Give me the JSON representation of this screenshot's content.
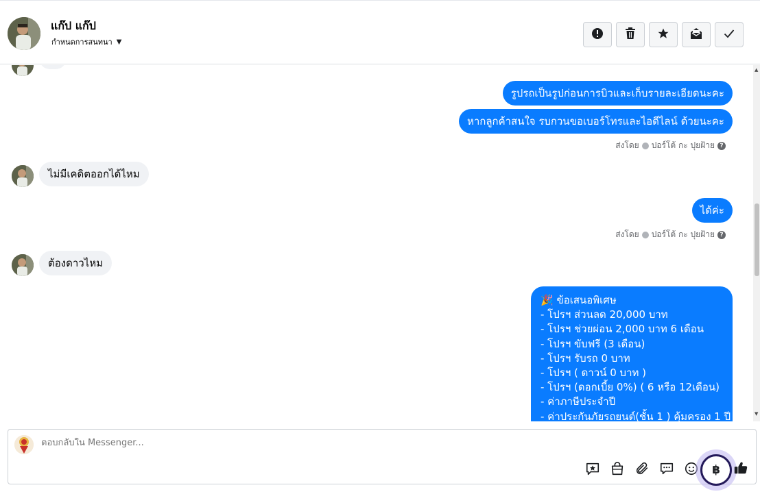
{
  "header": {
    "contact_name": "แก๊ป แก๊ป",
    "assign_label": "กำหนดการสนทนา",
    "buttons": [
      {
        "name": "report-button",
        "icon": "exclamation-circle-icon"
      },
      {
        "name": "delete-button",
        "icon": "trash-icon"
      },
      {
        "name": "star-button",
        "icon": "star-icon"
      },
      {
        "name": "mark-unread-button",
        "icon": "envelope-open-icon"
      },
      {
        "name": "done-button",
        "icon": "checkmark-icon"
      }
    ]
  },
  "thread": {
    "messages": [
      {
        "from": "page",
        "text": "รูปรถเป็นรูปก่อนการบิวและเก็บรายละเอียดนะคะ"
      },
      {
        "from": "page",
        "text": "หากลูกค้าสนใจ รบกวนขอเบอร์โทรและไอดีไลน์ ด้วยนะคะ"
      },
      {
        "from": "customer",
        "text": "ไม่มีเคดิตออกได้ไหม"
      },
      {
        "from": "page",
        "text": "ได้ค่ะ"
      },
      {
        "from": "customer",
        "text": "ต้องดาวไหม"
      }
    ],
    "sent_by_1": "ส่งโดย",
    "sent_by_name_1": "ปอร์โต้ กะ ปุยฝ้าย",
    "sent_by_2": "ส่งโดย",
    "sent_by_name_2": "ปอร์โต้ กะ ปุยฝ้าย",
    "help_glyph": "?",
    "offer": {
      "emoji": "🎉",
      "title": "ข้อเสนอพิเศษ",
      "lines": [
        "- โปรฯ ส่วนลด 20,000 บาท",
        "- โปรฯ ช่วยผ่อน 2,000 บาท 6 เดือน",
        "- โปรฯ ขับฟรี (3 เดือน)",
        "- โปรฯ รับรถ 0 บาท",
        "- โปรฯ ( ดาวน์ 0 บาท )",
        "- โปรฯ (ดอกเบี้ย 0%) ( 6 หรือ 12เดือน)",
        "- ค่าภาษีประจำปี",
        "- ค่าประกันภัยรถยนต์(ชั้น 1 ) คุ้มครอง 1 ปี"
      ]
    }
  },
  "composer": {
    "placeholder": "ตอบกลับใน Messenger...",
    "tools": [
      "saved-reply-icon",
      "shopping-bag-icon",
      "paperclip-icon",
      "chat-bubbles-icon",
      "smiley-icon",
      "baht-icon",
      "thumbs-up-icon"
    ],
    "baht_glyph": "฿"
  },
  "colors": {
    "outgoing_bubble": "#0a7cff",
    "incoming_bubble": "#f0f2f5",
    "highlight_ring": "#241a5a"
  }
}
